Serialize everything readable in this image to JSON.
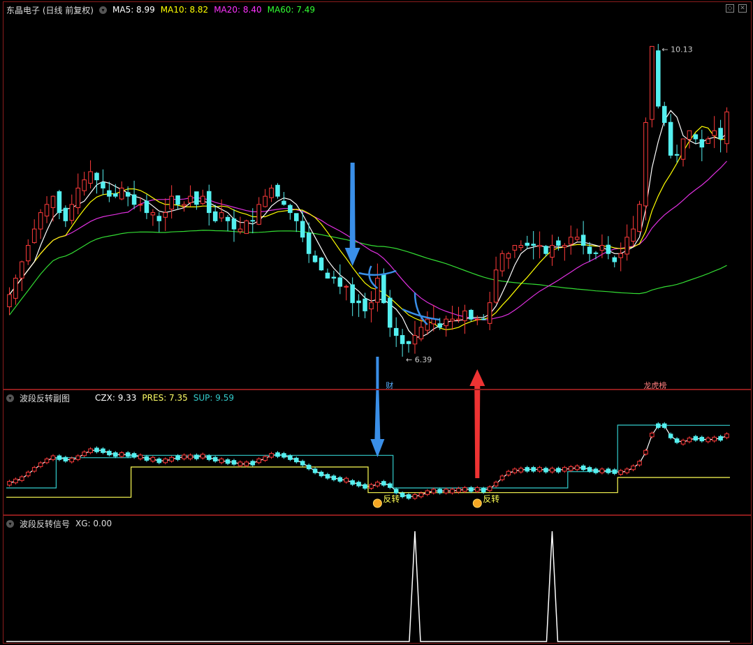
{
  "main": {
    "title": "东晶电子 (日线 前复权)",
    "ma5": "MA5: 8.99",
    "ma10": "MA10: 8.82",
    "ma20": "MA20: 8.40",
    "ma60": "MA60: 7.49",
    "high_label": "10.13",
    "low_label": "6.39",
    "marker_cai": "财",
    "marker_lhb": "龙虎榜"
  },
  "sub1": {
    "title": "波段反转副图",
    "czx": "CZX: 9.33",
    "pres": "PRES: 7.35",
    "sup": "SUP: 9.59",
    "signal_label": "反转"
  },
  "sub2": {
    "title": "波段反转信号",
    "xg": "XG: 0.00"
  },
  "colors": {
    "up": "#ff3b3b",
    "down": "#54f0f0",
    "ma5": "#ffffff",
    "ma10": "#ffff00",
    "ma20": "#e030e0",
    "ma60": "#33dd33",
    "border": "#8b1c1c",
    "arrow_blue": "#3a8fe8",
    "arrow_red": "#ee3333"
  },
  "chart_data": [
    {
      "type": "candlestick",
      "title": "东晶电子 (日线 前复权)",
      "ylim": [
        6.0,
        10.5
      ],
      "series": [
        {
          "name": "MA5",
          "last": 8.99
        },
        {
          "name": "MA10",
          "last": 8.82
        },
        {
          "name": "MA20",
          "last": 8.4
        },
        {
          "name": "MA60",
          "last": 7.49
        }
      ],
      "close": [
        7.1,
        7.3,
        7.5,
        7.7,
        7.9,
        8.1,
        8.2,
        8.3,
        8.1,
        8.0,
        8.2,
        8.4,
        8.5,
        8.6,
        8.5,
        8.4,
        8.3,
        8.3,
        8.4,
        8.3,
        8.2,
        8.2,
        8.1,
        8.1,
        8.0,
        8.1,
        8.3,
        8.2,
        8.2,
        8.3,
        8.2,
        8.3,
        8.1,
        8.0,
        8.1,
        8.0,
        7.9,
        7.9,
        8.0,
        8.0,
        8.2,
        8.3,
        8.4,
        8.3,
        8.2,
        8.1,
        8.0,
        7.8,
        7.6,
        7.5,
        7.4,
        7.3,
        7.3,
        7.2,
        7.2,
        7.0,
        7.0,
        6.9,
        7.0,
        7.3,
        7.0,
        6.7,
        6.6,
        6.5,
        6.5,
        6.6,
        6.7,
        6.8,
        6.8,
        6.7,
        6.8,
        6.8,
        6.8,
        6.9,
        6.8,
        6.8,
        6.8,
        7.0,
        7.4,
        7.6,
        7.6,
        7.7,
        7.7,
        7.7,
        7.7,
        7.7,
        7.6,
        7.7,
        7.7,
        7.7,
        7.8,
        7.8,
        7.7,
        7.6,
        7.6,
        7.7,
        7.6,
        7.5,
        7.6,
        7.8,
        7.9,
        8.2,
        9.2,
        10.13,
        9.4,
        9.2,
        8.8,
        8.8,
        9.0,
        9.1,
        9.0,
        8.9,
        9.0,
        9.1,
        9.0,
        9.33
      ]
    },
    {
      "type": "line",
      "title": "波段反转副图",
      "series": [
        {
          "name": "CZX",
          "last": 9.33
        },
        {
          "name": "PRES",
          "last": 7.35
        },
        {
          "name": "SUP",
          "last": 9.59
        }
      ],
      "annotations": [
        "反转",
        "反转"
      ]
    },
    {
      "type": "line",
      "title": "波段反转信号",
      "series": [
        {
          "name": "XG",
          "last": 0.0
        }
      ],
      "signal_peaks_at_index": [
        71,
        93
      ]
    }
  ]
}
